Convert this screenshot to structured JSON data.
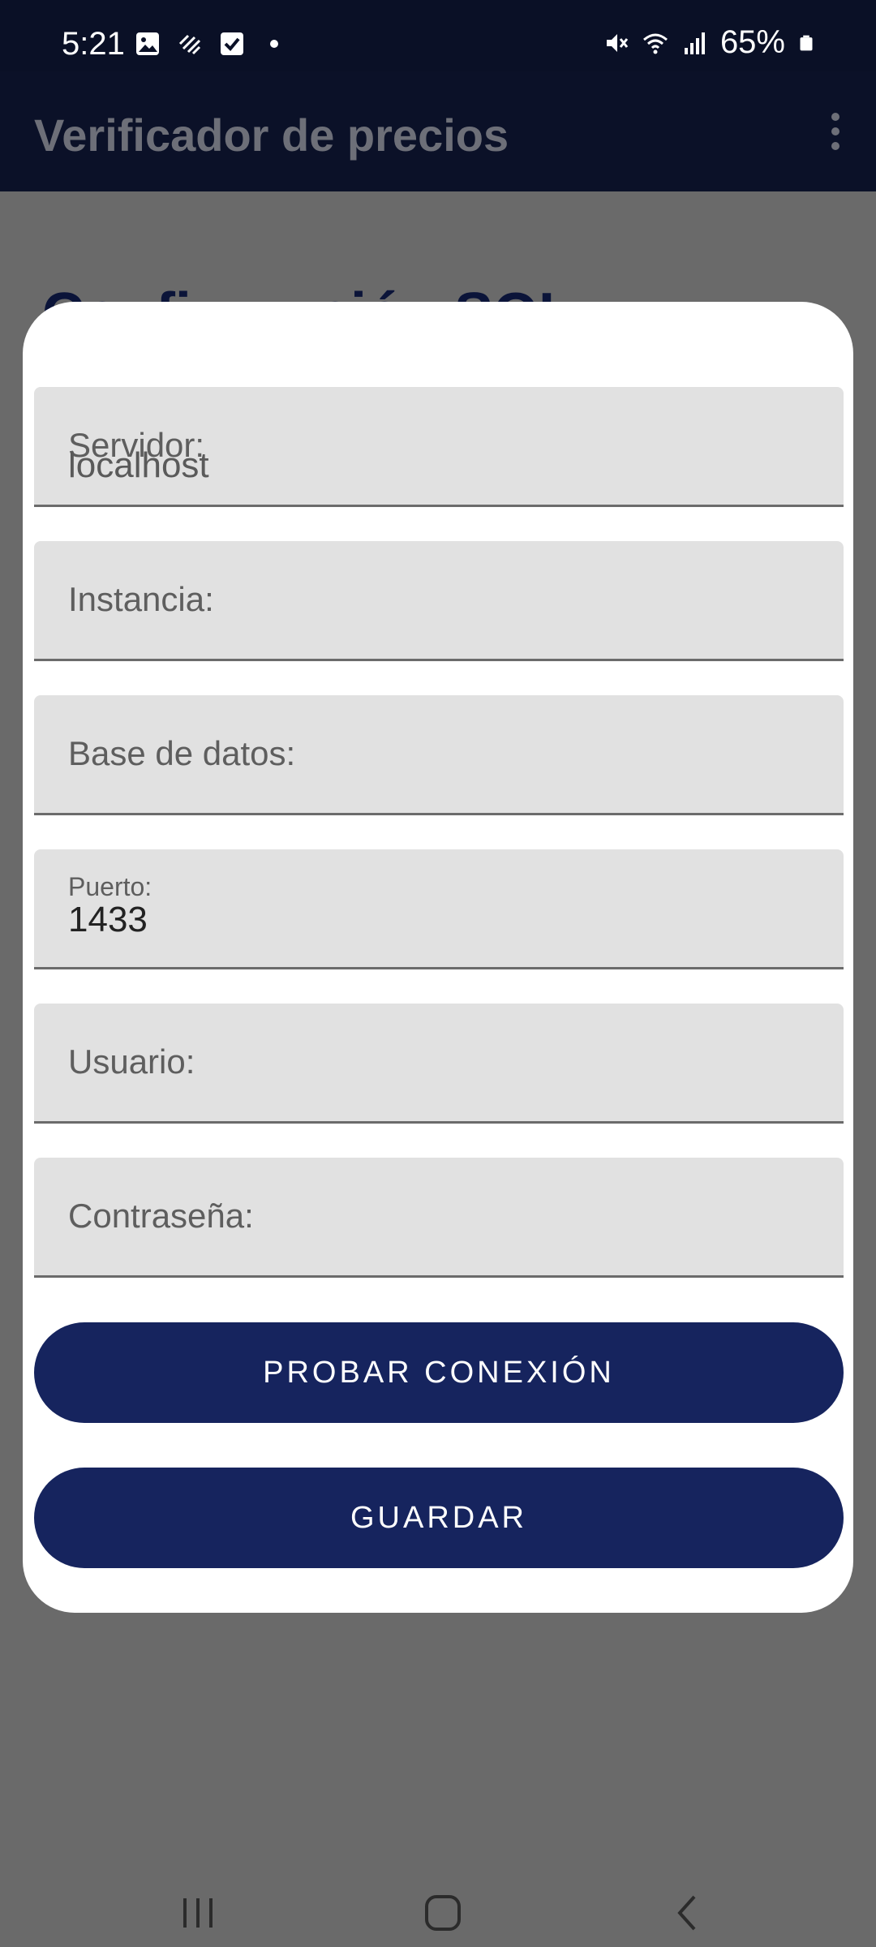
{
  "status_bar": {
    "time": "5:21",
    "battery": "65%",
    "icons": [
      "image-icon",
      "sync-icon",
      "check-icon",
      "dot-icon",
      "mute-icon",
      "wifi-icon",
      "signal-icon",
      "battery-icon"
    ]
  },
  "app_bar": {
    "title": "Verificador de precios",
    "menu_icon": "overflow-menu-icon"
  },
  "background": {
    "heading": "Configuración SQL"
  },
  "dialog": {
    "fields": [
      {
        "label": "Servidor:",
        "value": "localhost"
      },
      {
        "label": "Instancia:",
        "value": ""
      },
      {
        "label": "Base de datos:",
        "value": ""
      },
      {
        "label": "Puerto:",
        "value": "1433"
      },
      {
        "label": "Usuario:",
        "value": ""
      },
      {
        "label": "Contraseña:",
        "value": ""
      }
    ],
    "test_button": "PROBAR CONEXIÓN",
    "save_button": "GUARDAR"
  },
  "nav_bar": {
    "icons": [
      "recent-apps-icon",
      "home-icon",
      "back-icon"
    ]
  },
  "colors": {
    "primary_dark": "#0b1128",
    "button": "#16245e",
    "scrim": "#6a6a6a",
    "field_bg": "#e1e1e1"
  }
}
